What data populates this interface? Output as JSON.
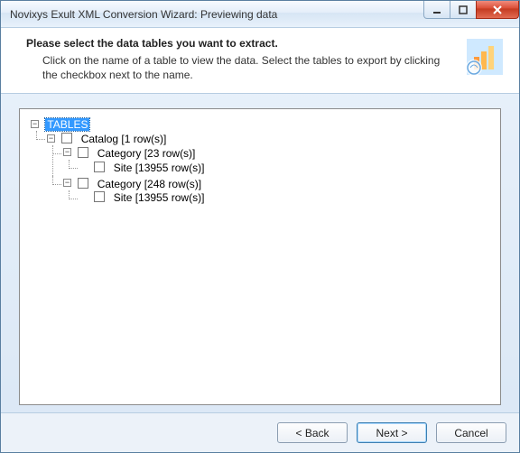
{
  "window": {
    "title": "Novixys Exult XML Conversion Wizard: Previewing data"
  },
  "header": {
    "heading": "Please select the data tables you want to extract.",
    "sub": "Click on the name of a table to view the data. Select the tables to export by clicking the checkbox next to the name."
  },
  "tree": {
    "root": {
      "label": "TABLES",
      "selected": true,
      "expanded": true
    },
    "catalog": {
      "label": "Catalog [1 row(s)]",
      "expanded": true
    },
    "category1": {
      "label": "Category [23 row(s)]",
      "expanded": true
    },
    "site1": {
      "label": "Site [13955 row(s)]"
    },
    "category2": {
      "label": "Category [248 row(s)]",
      "expanded": true
    },
    "site2": {
      "label": "Site [13955 row(s)]"
    }
  },
  "footer": {
    "back": "< Back",
    "next": "Next >",
    "cancel": "Cancel"
  }
}
